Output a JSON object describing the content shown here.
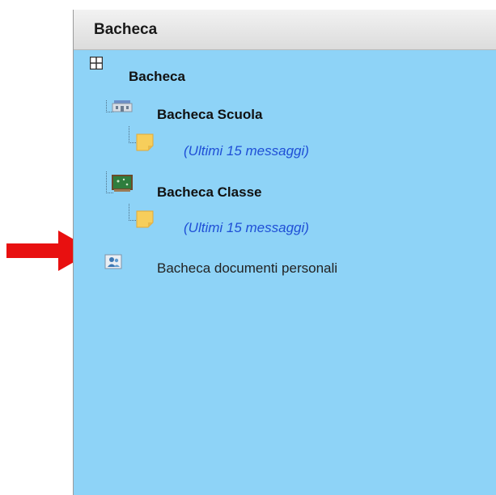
{
  "panel": {
    "header_title": "Bacheca"
  },
  "tree": {
    "root_label": "Bacheca",
    "scuola_label": "Bacheca Scuola",
    "scuola_messages": "(Ultimi 15 messaggi)",
    "classe_label": "Bacheca Classe",
    "classe_messages": "(Ultimi 15 messaggi)",
    "personal_docs_label": "Bacheca documenti personali"
  },
  "colors": {
    "panel_bg": "#8ed3f7",
    "link": "#1f4fd6",
    "arrow": "#e81010"
  },
  "icons": {
    "root": "grid-icon",
    "scuola": "school-board-icon",
    "classe": "class-board-icon",
    "note": "sticky-note-icon",
    "personal": "personal-docs-icon",
    "pointer": "red-arrow-icon"
  }
}
